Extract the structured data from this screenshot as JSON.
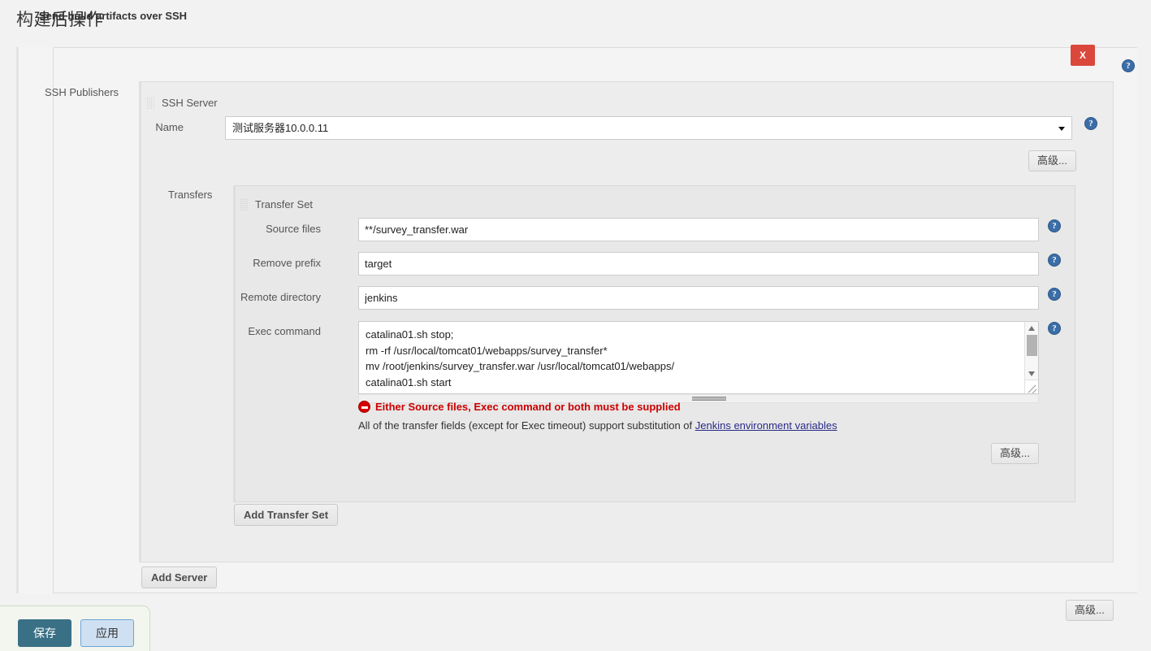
{
  "page": {
    "title": "构建后操作"
  },
  "section": {
    "title": "Send build artifacts over SSH",
    "grip_icon": "drag-grip-icon",
    "close_label": "X",
    "help_icon": "help-icon"
  },
  "publishers": {
    "label": "SSH Publishers"
  },
  "ssh_server": {
    "group_title": "SSH Server",
    "name_label": "Name",
    "name_value": "测试服务器10.0.0.11",
    "dropdown_icon": "chevron-down-icon",
    "advanced_label": "高级...",
    "help_icon": "help-icon"
  },
  "transfers": {
    "label": "Transfers",
    "group_title": "Transfer Set",
    "fields": [
      {
        "label": "Source files",
        "value": "**/survey_transfer.war",
        "name": "source-files"
      },
      {
        "label": "Remove prefix",
        "value": "target",
        "name": "remove-prefix"
      },
      {
        "label": "Remote directory",
        "value": "jenkins",
        "name": "remote-directory"
      }
    ],
    "exec": {
      "label": "Exec command",
      "value": "catalina01.sh stop;\nrm -rf /usr/local/tomcat01/webapps/survey_transfer*\nmv /root/jenkins/survey_transfer.war /usr/local/tomcat01/webapps/\ncatalina01.sh start"
    },
    "error_message": "Either Source files, Exec command or both must be supplied",
    "hint_prefix": "All of the transfer fields (except for Exec timeout) support substitution of ",
    "hint_link": "Jenkins environment variables",
    "advanced_label": "高级...",
    "add_transfer_set_label": "Add Transfer Set"
  },
  "actions": {
    "add_server_label": "Add Server",
    "advanced_label": "高级...",
    "save_label": "保存",
    "apply_label": "应用"
  },
  "colors": {
    "close_button": "#d9483b",
    "error_text": "#cc0000",
    "help_icon": "#3b6ea8",
    "save_button": "#3a7086",
    "apply_button": "#cfe0f2",
    "link": "#2a2a8a"
  }
}
